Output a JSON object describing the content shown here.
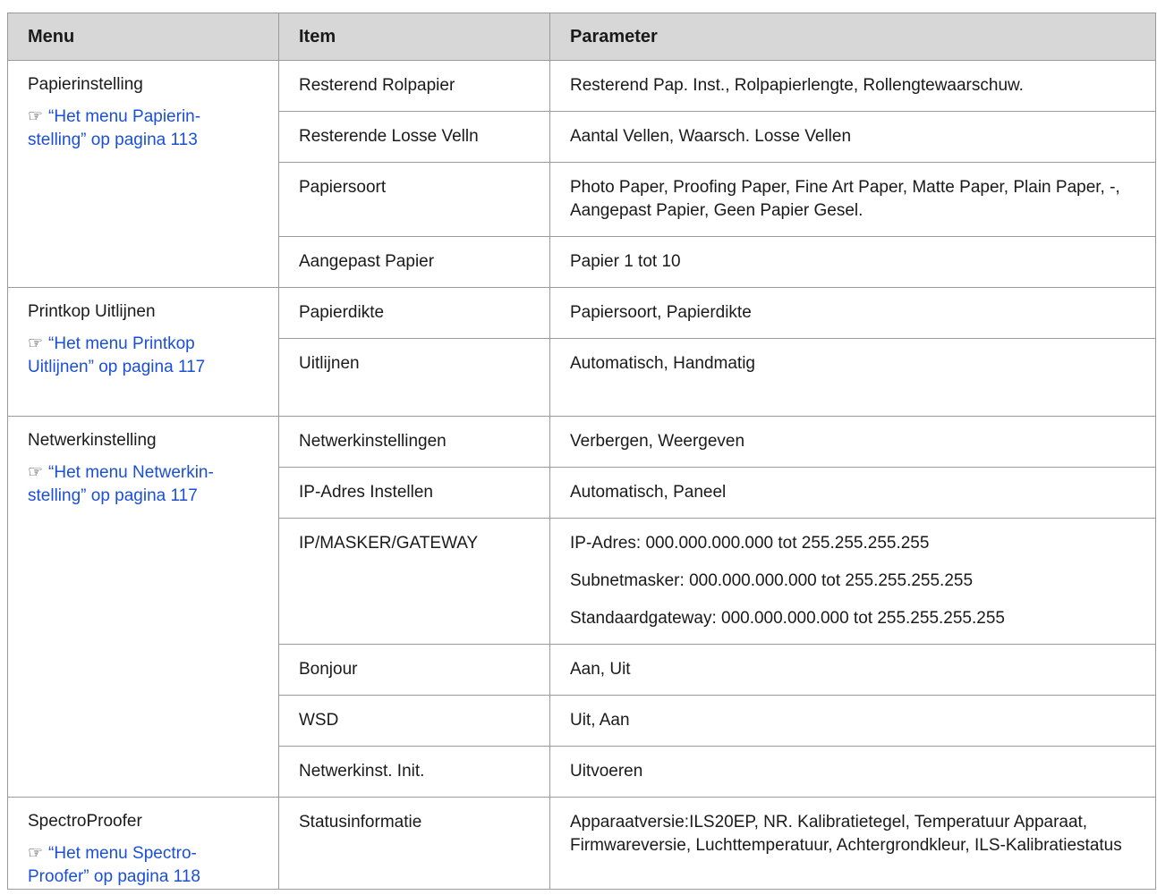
{
  "header": {
    "menu": "Menu",
    "item": "Item",
    "parameter": "Parameter"
  },
  "groups": [
    {
      "menu": "Papierinstelling",
      "link_line1": "“Het menu Papierin-",
      "link_line2": "stelling” op pagina 113",
      "rows": [
        {
          "item": "Resterend Rolpapier",
          "params": [
            "Resterend Pap. Inst., Rolpapierlengte, Rollengtewaarschuw."
          ]
        },
        {
          "item": "Resterende Losse Velln",
          "params": [
            "Aantal Vellen, Waarsch. Losse Vellen"
          ]
        },
        {
          "item": "Papiersoort",
          "params": [
            "Photo Paper, Proofing Paper, Fine Art Paper, Matte Paper, Plain Paper, -, Aangepast Papier, Geen Papier Gesel."
          ]
        },
        {
          "item": "Aangepast Papier",
          "params": [
            "Papier 1 tot 10"
          ]
        }
      ]
    },
    {
      "menu": "Printkop Uitlijnen",
      "link_line1": "“Het menu Printkop",
      "link_line2": "Uitlijnen” op pagina 117",
      "rows": [
        {
          "item": "Papierdikte",
          "params": [
            "Papiersoort, Papierdikte"
          ]
        },
        {
          "item": "Uitlijnen",
          "params": [
            "Automatisch, Handmatig"
          ]
        }
      ]
    },
    {
      "menu": "Netwerkinstelling",
      "link_line1": "“Het menu Netwerkin-",
      "link_line2": "stelling” op pagina 117",
      "rows": [
        {
          "item": "Netwerkinstellingen",
          "params": [
            "Verbergen, Weergeven"
          ]
        },
        {
          "item": "IP-Adres Instellen",
          "params": [
            "Automatisch, Paneel"
          ]
        },
        {
          "item": "IP/MASKER/GATEWAY",
          "params": [
            "IP-Adres: 000.000.000.000 tot 255.255.255.255",
            "Subnetmasker: 000.000.000.000 tot 255.255.255.255",
            "Standaardgateway: 000.000.000.000 tot 255.255.255.255"
          ]
        },
        {
          "item": "Bonjour",
          "params": [
            "Aan, Uit"
          ]
        },
        {
          "item": "WSD",
          "params": [
            "Uit, Aan"
          ]
        },
        {
          "item": "Netwerkinst. Init.",
          "params": [
            "Uitvoeren"
          ]
        }
      ]
    },
    {
      "menu": "SpectroProofer",
      "link_line1": "“Het menu Spectro-",
      "link_line2": "Proofer” op pagina 118",
      "rows": [
        {
          "item": "Statusinformatie",
          "params": [
            "Apparaatversie:ILS20EP, NR. Kalibratietegel, Temperatuur Apparaat, Firmwareversie, Luchttemperatuur, Achtergrondkleur, ILS-Kalibratiestatus"
          ]
        }
      ]
    }
  ]
}
